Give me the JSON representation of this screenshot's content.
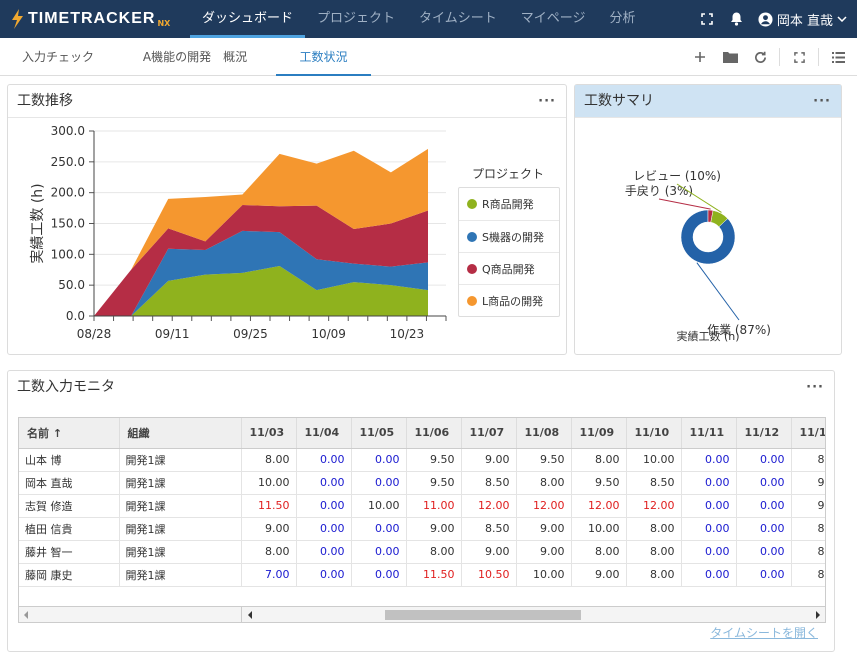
{
  "app": {
    "logo_text": "TIMETRACKER",
    "logo_suffix": "NX"
  },
  "nav": [
    {
      "label": "ダッシュボード",
      "active": true
    },
    {
      "label": "プロジェクト"
    },
    {
      "label": "タイムシート"
    },
    {
      "label": "マイページ"
    },
    {
      "label": "分析"
    }
  ],
  "user": {
    "name": "岡本 直哉"
  },
  "tabs": [
    {
      "label": "入力チェック"
    },
    {
      "label": "A機能の開発　概況"
    },
    {
      "label": "工数状況",
      "active": true
    }
  ],
  "icons": {
    "logo": "logo-icon",
    "fullscreen": "fullscreen-icon",
    "bell": "bell-icon",
    "user": "user-circle-icon",
    "chevron": "chevron-down-icon",
    "add": "plus-icon",
    "folder": "folder-icon",
    "refresh": "refresh-icon",
    "expand": "expand-icon",
    "list": "list-icon",
    "more": "more-icon"
  },
  "colors": {
    "topbar": "#1f3a5c",
    "accent": "#2b7ec1",
    "panel_header_blue": "#cfe3f3"
  },
  "panels": {
    "trend": {
      "title": "工数推移",
      "menu": "···"
    },
    "summary": {
      "title": "工数サマリ",
      "menu": "···"
    },
    "monitor": {
      "title": "工数入力モニタ",
      "menu": "···",
      "link": "タイムシートを開く"
    }
  },
  "chart_data": [
    {
      "type": "area",
      "stacked": true,
      "ylabel": "実績工数 (h)",
      "ylim": [
        0,
        300
      ],
      "yticks": [
        "0.0",
        "50.0",
        "100.0",
        "150.0",
        "200.0",
        "250.0",
        "300.0"
      ],
      "xticks": [
        "08/28",
        "09/11",
        "09/25",
        "10/09",
        "10/23"
      ],
      "legend_title": "プロジェクト",
      "legend_position": "right",
      "x": [
        "08/28",
        "09/04",
        "09/11",
        "09/18",
        "09/25",
        "10/02",
        "10/09",
        "10/16",
        "10/23",
        "10/30"
      ],
      "series": [
        {
          "name": "R商品開発",
          "color": "#8fb21e",
          "values": [
            0,
            0,
            57,
            67,
            70,
            81,
            42,
            55,
            50,
            42
          ]
        },
        {
          "name": "S機器の開発",
          "color": "#2f75b5",
          "values": [
            0,
            0,
            52,
            40,
            68,
            55,
            50,
            30,
            30,
            45
          ]
        },
        {
          "name": "Q商品開発",
          "color": "#b52d45",
          "values": [
            0,
            75,
            33,
            14,
            42,
            42,
            87,
            56,
            70,
            84
          ]
        },
        {
          "name": "L商品の開発",
          "color": "#f5972f",
          "values": [
            0,
            0,
            48,
            72,
            17,
            85,
            68,
            127,
            83,
            100
          ]
        }
      ]
    },
    {
      "type": "pie",
      "donut": true,
      "xlabel": "実績工数 (h)",
      "slices": [
        {
          "label": "作業 (87%)",
          "value": 87,
          "color": "#2462a8"
        },
        {
          "label": "手戻り (3%)",
          "value": 3,
          "color": "#b52d45"
        },
        {
          "label": "レビュー (10%)",
          "value": 10,
          "color": "#8fb21e"
        }
      ]
    }
  ],
  "table": {
    "columns": [
      "名前 ↑",
      "組織",
      "11/03",
      "11/04",
      "11/05",
      "11/06",
      "11/07",
      "11/08",
      "11/09",
      "11/10",
      "11/11",
      "11/12",
      "11/1"
    ],
    "rows": [
      {
        "name": "山本 博",
        "org": "開発1課",
        "cells": [
          [
            "8.00",
            "n"
          ],
          [
            "0.00",
            "b"
          ],
          [
            "0.00",
            "b"
          ],
          [
            "9.50",
            "n"
          ],
          [
            "9.00",
            "n"
          ],
          [
            "9.50",
            "n"
          ],
          [
            "8.00",
            "n"
          ],
          [
            "10.00",
            "n"
          ],
          [
            "0.00",
            "b"
          ],
          [
            "0.00",
            "b"
          ],
          [
            "8",
            "n"
          ]
        ]
      },
      {
        "name": "岡本 直哉",
        "org": "開発1課",
        "cells": [
          [
            "10.00",
            "n"
          ],
          [
            "0.00",
            "b"
          ],
          [
            "0.00",
            "b"
          ],
          [
            "9.50",
            "n"
          ],
          [
            "8.50",
            "n"
          ],
          [
            "8.00",
            "n"
          ],
          [
            "9.50",
            "n"
          ],
          [
            "8.50",
            "n"
          ],
          [
            "0.00",
            "b"
          ],
          [
            "0.00",
            "b"
          ],
          [
            "9",
            "n"
          ]
        ]
      },
      {
        "name": "志賀 修造",
        "org": "開発1課",
        "cells": [
          [
            "11.50",
            "r"
          ],
          [
            "0.00",
            "b"
          ],
          [
            "10.00",
            "n"
          ],
          [
            "11.00",
            "r"
          ],
          [
            "12.00",
            "r"
          ],
          [
            "12.00",
            "r"
          ],
          [
            "12.00",
            "r"
          ],
          [
            "12.00",
            "r"
          ],
          [
            "0.00",
            "b"
          ],
          [
            "0.00",
            "b"
          ],
          [
            "9",
            "n"
          ]
        ]
      },
      {
        "name": "植田 信貴",
        "org": "開発1課",
        "cells": [
          [
            "9.00",
            "n"
          ],
          [
            "0.00",
            "b"
          ],
          [
            "0.00",
            "b"
          ],
          [
            "9.00",
            "n"
          ],
          [
            "8.50",
            "n"
          ],
          [
            "9.00",
            "n"
          ],
          [
            "10.00",
            "n"
          ],
          [
            "8.00",
            "n"
          ],
          [
            "0.00",
            "b"
          ],
          [
            "0.00",
            "b"
          ],
          [
            "8",
            "n"
          ]
        ]
      },
      {
        "name": "藤井 智一",
        "org": "開発1課",
        "cells": [
          [
            "8.00",
            "n"
          ],
          [
            "0.00",
            "b"
          ],
          [
            "0.00",
            "b"
          ],
          [
            "8.00",
            "n"
          ],
          [
            "9.00",
            "n"
          ],
          [
            "9.00",
            "n"
          ],
          [
            "8.00",
            "n"
          ],
          [
            "8.00",
            "n"
          ],
          [
            "0.00",
            "b"
          ],
          [
            "0.00",
            "b"
          ],
          [
            "8",
            "n"
          ]
        ]
      },
      {
        "name": "藤岡 康史",
        "org": "開発1課",
        "cells": [
          [
            "7.00",
            "b"
          ],
          [
            "0.00",
            "b"
          ],
          [
            "0.00",
            "b"
          ],
          [
            "11.50",
            "r"
          ],
          [
            "10.50",
            "r"
          ],
          [
            "10.00",
            "n"
          ],
          [
            "9.00",
            "n"
          ],
          [
            "8.00",
            "n"
          ],
          [
            "0.00",
            "b"
          ],
          [
            "0.00",
            "b"
          ],
          [
            "8",
            "n"
          ]
        ]
      }
    ]
  }
}
